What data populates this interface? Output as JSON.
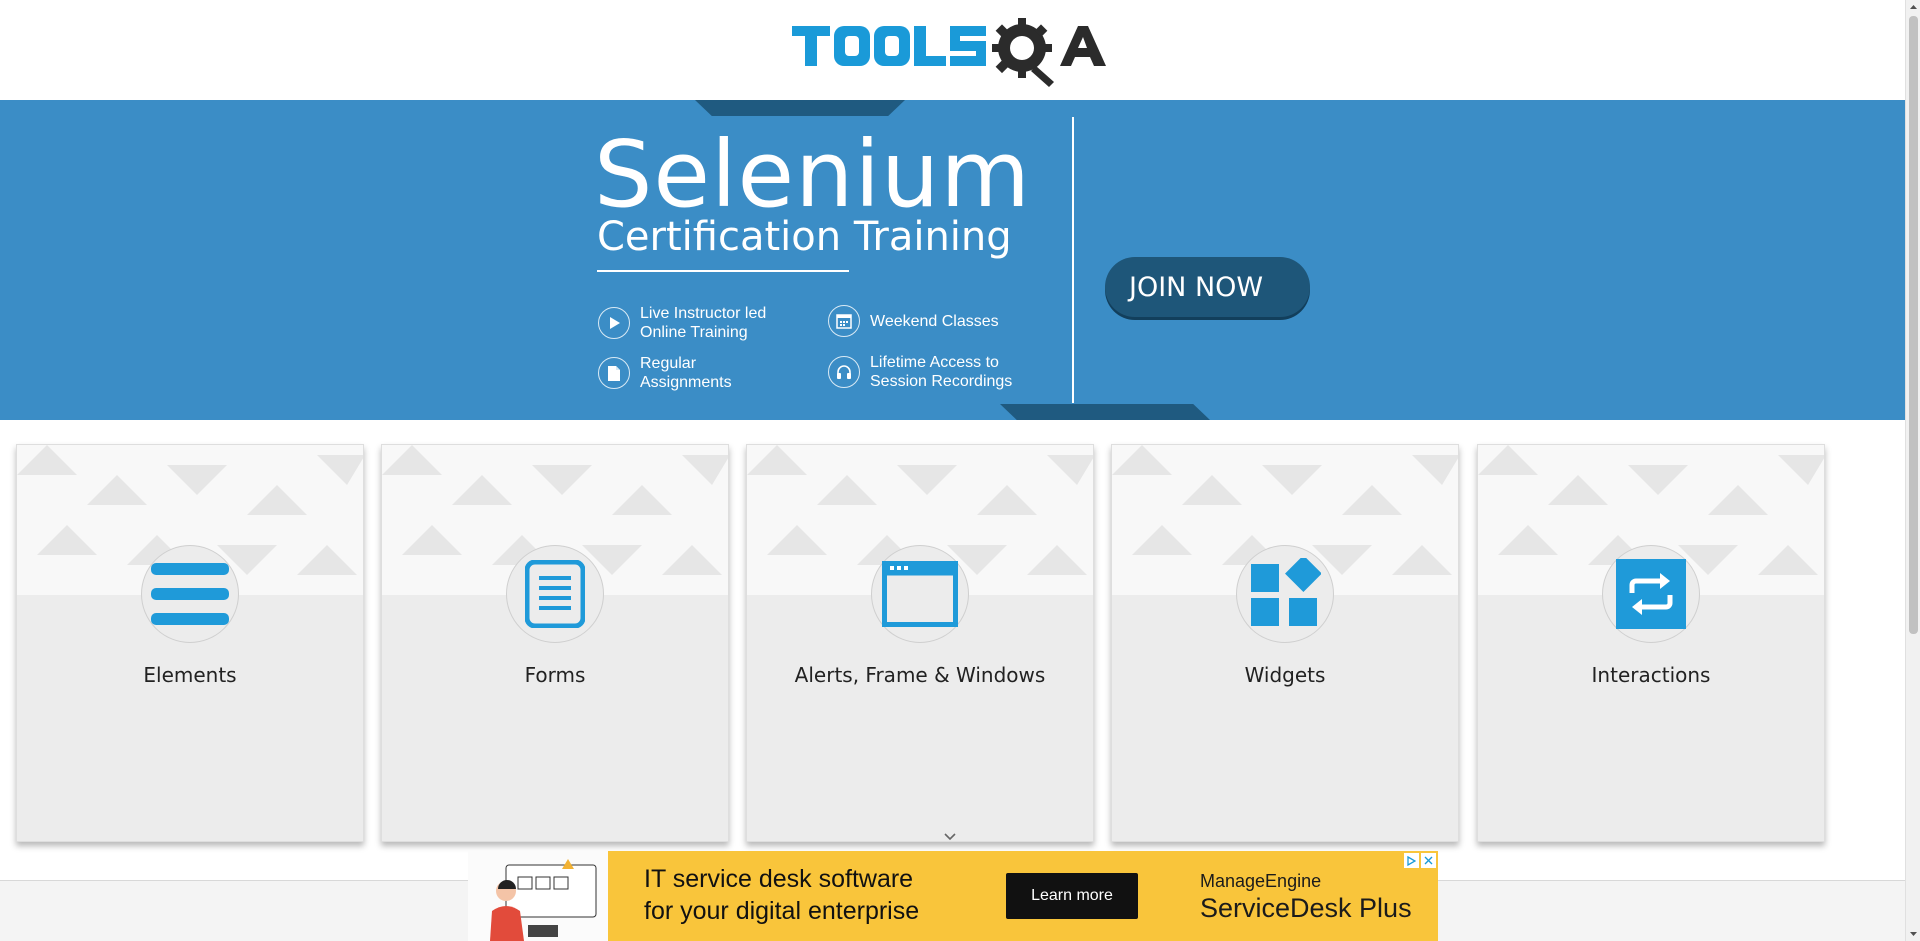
{
  "header": {
    "logo_text": "TOOLSQA"
  },
  "banner": {
    "title": "Selenium",
    "subtitle": "Certification Training",
    "features": [
      {
        "line1": "Live Instructor led",
        "line2": "Online Training",
        "icon": "play-icon"
      },
      {
        "line1": "Weekend Classes",
        "line2": "",
        "icon": "calendar-icon"
      },
      {
        "line1": "Regular",
        "line2": "Assignments",
        "icon": "document-icon"
      },
      {
        "line1": "Lifetime Access to",
        "line2": "Session Recordings",
        "icon": "headphones-icon"
      }
    ],
    "cta_label": "JOIN NOW"
  },
  "cards": [
    {
      "label": "Elements",
      "icon": "list-lines-icon"
    },
    {
      "label": "Forms",
      "icon": "form-document-icon"
    },
    {
      "label": "Alerts, Frame & Windows",
      "icon": "browser-window-icon"
    },
    {
      "label": "Widgets",
      "icon": "widgets-grid-icon"
    },
    {
      "label": "Interactions",
      "icon": "swap-arrows-icon"
    }
  ],
  "ad": {
    "headline_line1": "IT service desk software",
    "headline_line2": "for your digital enterprise",
    "cta_label": "Learn more",
    "brand_top": "ManageEngine",
    "brand_bottom": "ServiceDesk Plus"
  },
  "colors": {
    "brand_blue": "#1a9ad8",
    "banner_blue": "#3b8dc6",
    "banner_dark": "#1e5679",
    "card_icon_blue": "#1f9ad9",
    "ad_yellow": "#f9c53b"
  }
}
